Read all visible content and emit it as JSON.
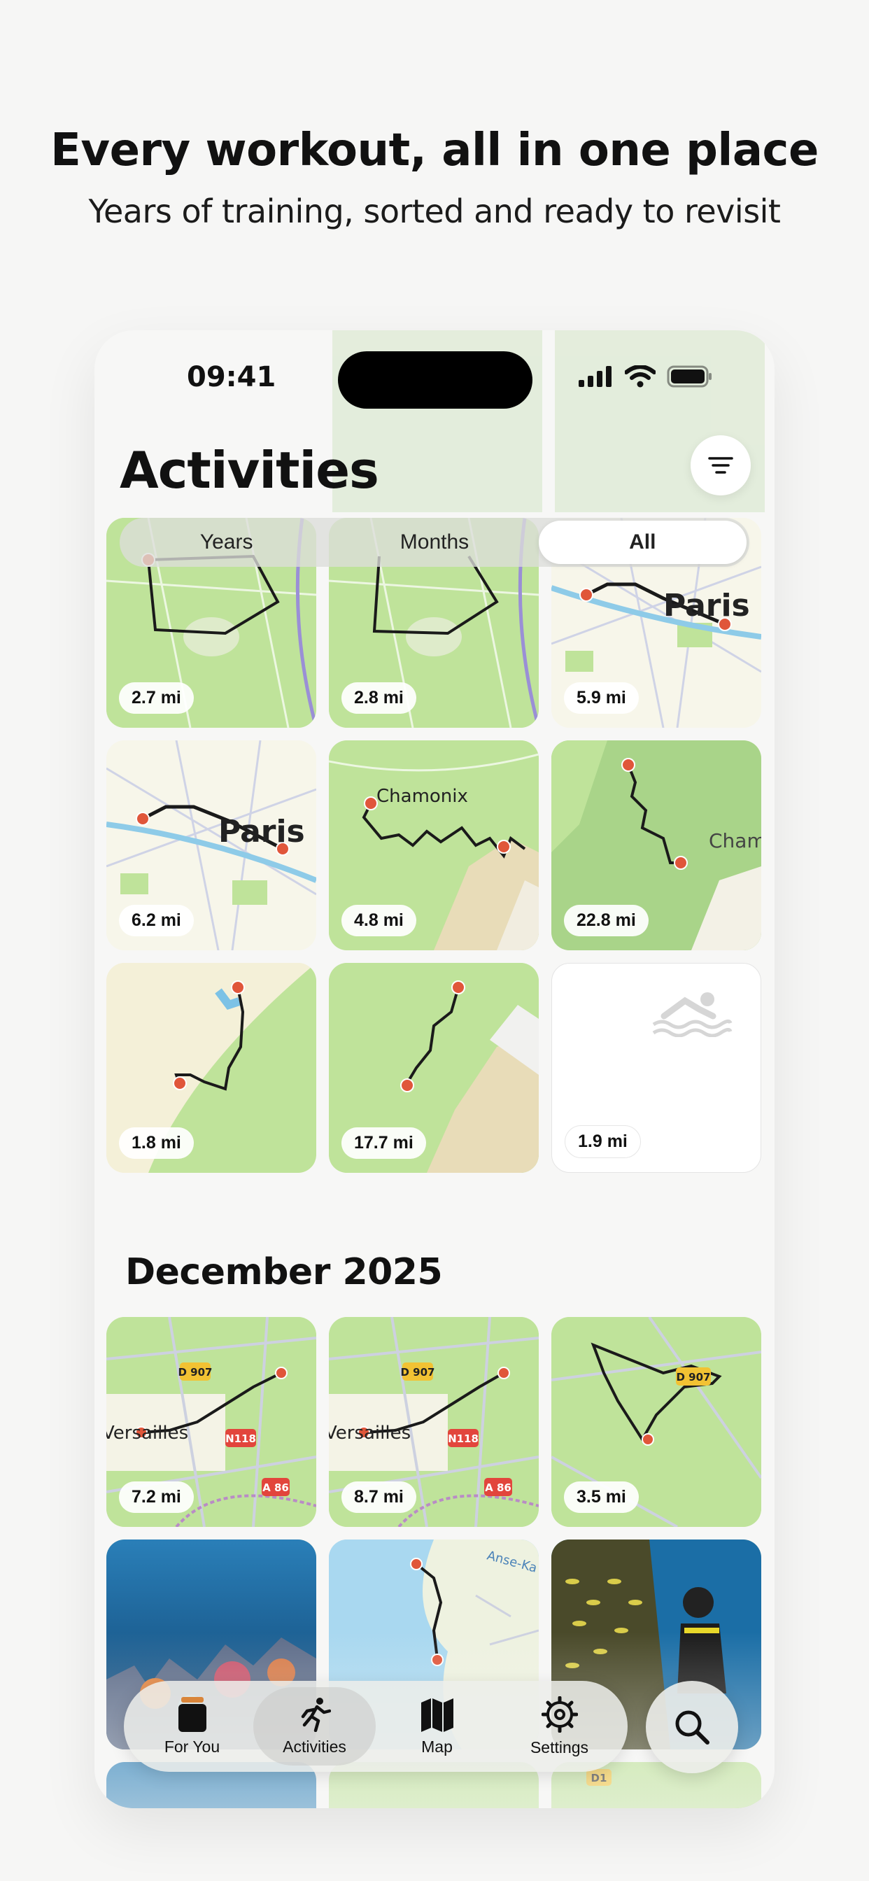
{
  "promo": {
    "headline": "Every workout, all in one place",
    "subline": "Years of training, sorted and ready to revisit"
  },
  "status_bar": {
    "time": "09:41",
    "icons": [
      "signal-icon",
      "wifi-icon",
      "battery-icon"
    ]
  },
  "header": {
    "title": "Activities",
    "filter_icon": "filter-icon"
  },
  "segmented": {
    "options": [
      "Years",
      "Months",
      "All"
    ],
    "selected": "All"
  },
  "top_tiles": [
    {
      "distance": "2.7 mi",
      "kind": "map",
      "map_label": ""
    },
    {
      "distance": "2.8 mi",
      "kind": "map",
      "map_label": ""
    },
    {
      "distance": "5.9 mi",
      "kind": "map",
      "map_label": "Paris"
    },
    {
      "distance": "6.2 mi",
      "kind": "map",
      "map_label": "Paris"
    },
    {
      "distance": "4.8 mi",
      "kind": "map",
      "map_label": "Chamonix"
    },
    {
      "distance": "22.8 mi",
      "kind": "map",
      "map_label": "Cham"
    },
    {
      "distance": "1.8 mi",
      "kind": "map",
      "map_label": ""
    },
    {
      "distance": "17.7 mi",
      "kind": "map",
      "map_label": ""
    },
    {
      "distance": "1.9 mi",
      "kind": "swim",
      "map_label": ""
    }
  ],
  "section": {
    "title": "December 2025"
  },
  "december_tiles": [
    {
      "distance": "7.2 mi",
      "road_labels": [
        "D 907",
        "N118",
        "A 86"
      ],
      "place": "Versailles"
    },
    {
      "distance": "8.7 mi",
      "road_labels": [
        "D 907",
        "N118",
        "A 86"
      ],
      "place": "Versailles"
    },
    {
      "distance": "3.5 mi",
      "road_labels": [
        "D 907"
      ],
      "place": ""
    }
  ],
  "photo_tiles": [
    {
      "kind": "reef-photo"
    },
    {
      "kind": "coast-map",
      "map_label": "Anse-Ka"
    },
    {
      "kind": "diver-photo"
    }
  ],
  "bottom_row_labels": [
    "D1"
  ],
  "tab_bar": {
    "tabs": [
      {
        "label": "For You",
        "icon": "jar-icon"
      },
      {
        "label": "Activities",
        "icon": "running-icon",
        "active": true
      },
      {
        "label": "Map",
        "icon": "map-icon"
      },
      {
        "label": "Settings",
        "icon": "gear-icon"
      }
    ],
    "search_icon": "search-icon"
  },
  "colors": {
    "route": "#1a1a1a",
    "route_endpoint": "#e0563a",
    "map_green": "#bfe39a",
    "map_light": "#f7f6ea",
    "water": "#a9d8f0",
    "road_badge_yellow": "#f2c233",
    "road_badge_red": "#e2453c"
  }
}
